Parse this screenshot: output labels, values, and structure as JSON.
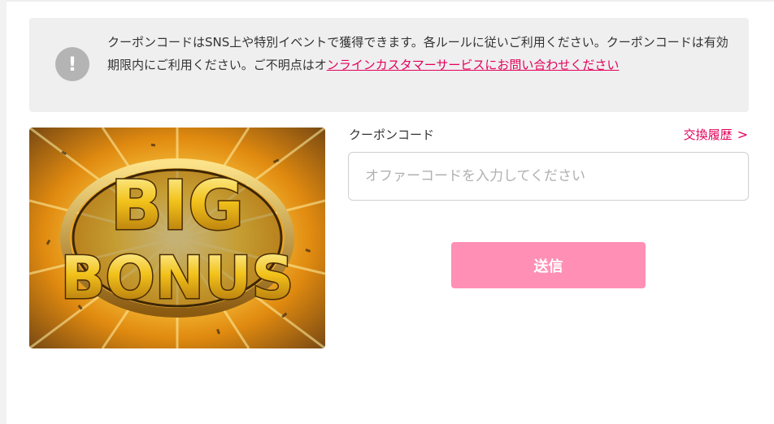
{
  "notice": {
    "icon": "exclamation-icon",
    "icon_glyph": "!",
    "text": "クーポンコードはSNS上や特別イベントで獲得できます。各ルールに従いご利用ください。クーポンコードは有効期限内にご利用ください。ご不明点はオ",
    "link": "ンラインカスタマーサービスにお問い合わせください"
  },
  "banner": {
    "line1": "BIG",
    "line2": "BONUS"
  },
  "form": {
    "label": "クーポンコード",
    "history_link": "交換履歴",
    "history_chevron": ">",
    "placeholder": "オファーコードを入力してください",
    "submit": "送信"
  },
  "colors": {
    "accent": "#e4005a",
    "button": "#ff8fb4",
    "notice_bg": "#efeff0"
  }
}
